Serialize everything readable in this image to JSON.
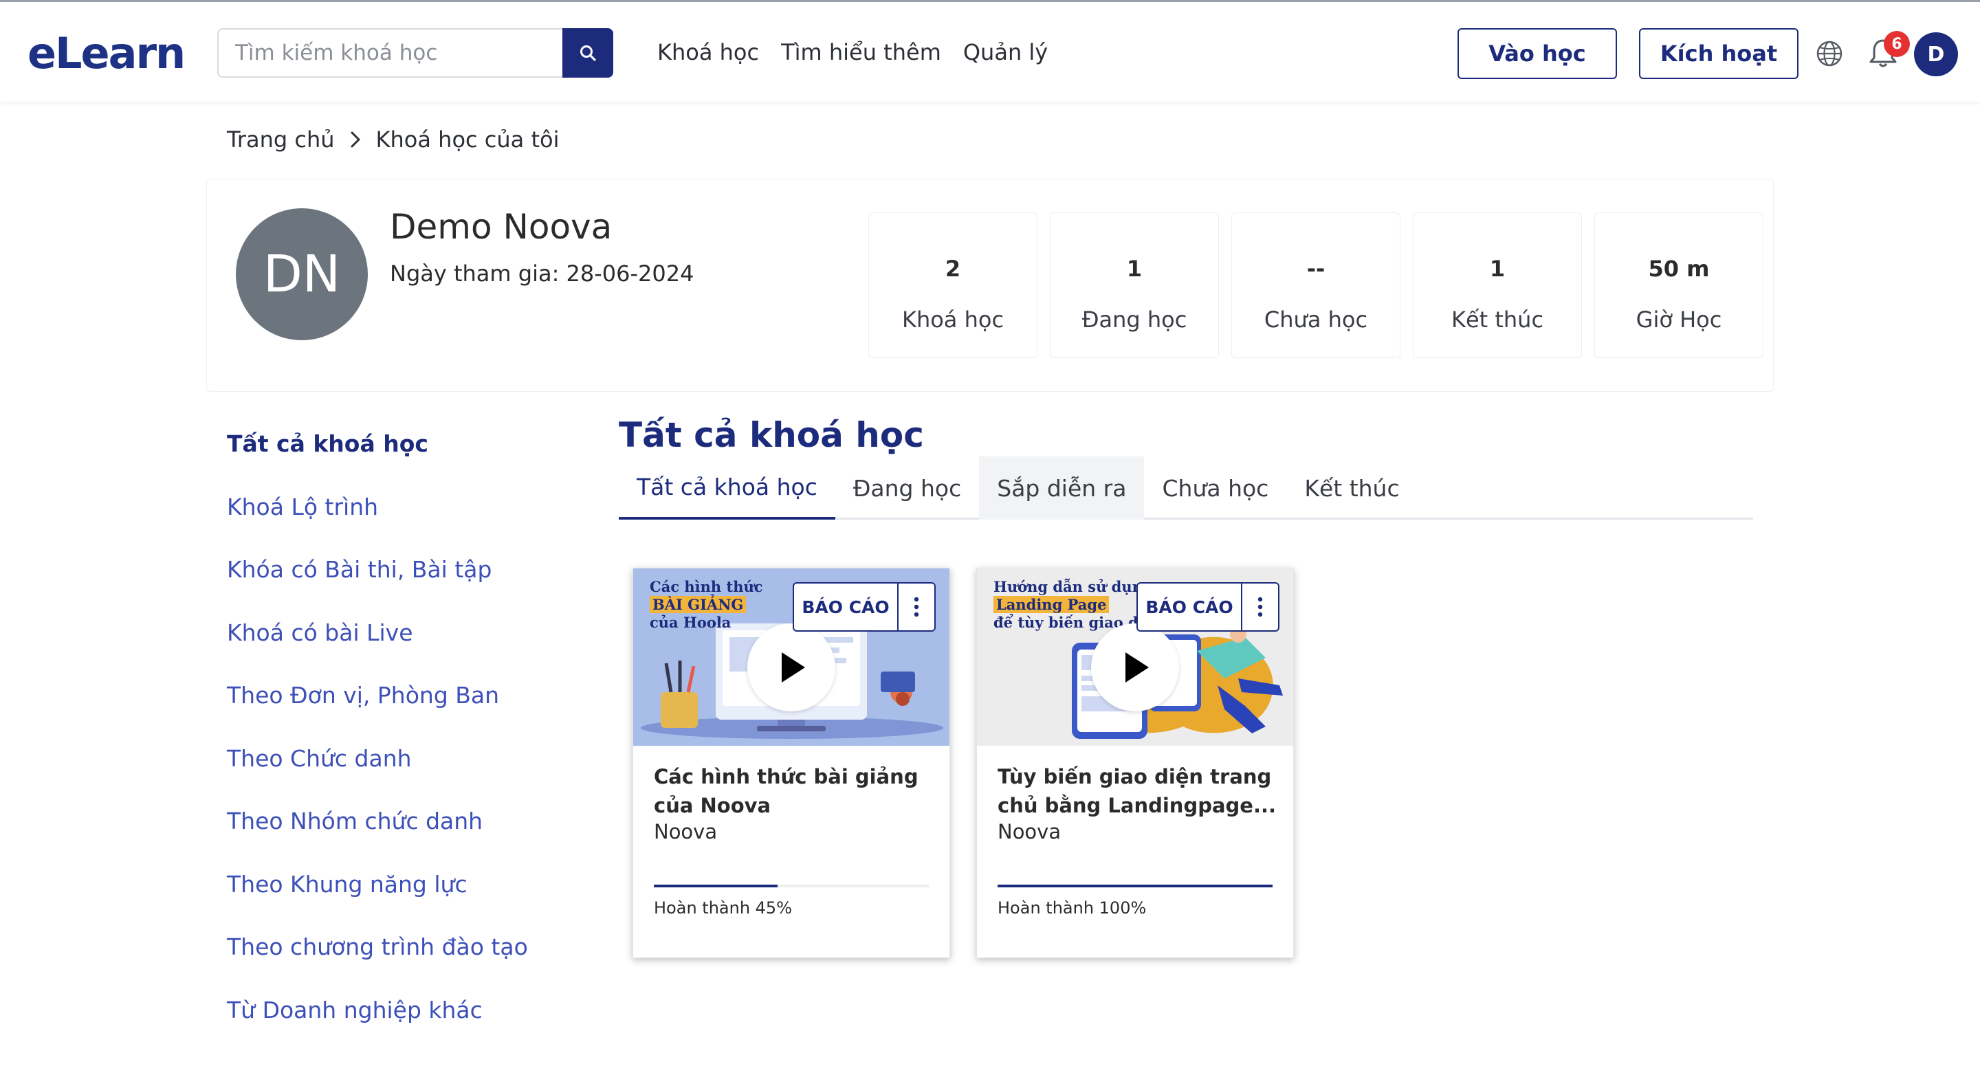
{
  "header": {
    "logo": "eLearn",
    "search_placeholder": "Tìm kiếm khoá học",
    "nav": [
      "Khoá học",
      "Tìm hiểu thêm",
      "Quản lý"
    ],
    "btn_vaohoc": "Vào học",
    "btn_kichhoat": "Kích hoạt",
    "notification_count": "6",
    "user_initial": "D",
    "accent": "#1d2b7d"
  },
  "breadcrumb": [
    "Trang chủ",
    "Khoá học của tôi"
  ],
  "profile": {
    "initials": "DN",
    "name": "Demo Noova",
    "joined": "Ngày tham gia: 28-06-2024",
    "stats": [
      {
        "value": "2",
        "label": "Khoá học"
      },
      {
        "value": "1",
        "label": "Đang học"
      },
      {
        "value": "--",
        "label": "Chưa học"
      },
      {
        "value": "1",
        "label": "Kết thúc"
      },
      {
        "value": "50 m",
        "label": "Giờ Học"
      }
    ]
  },
  "sidebar": [
    "Tất cả khoá học",
    "Khoá Lộ trình",
    "Khóa có Bài thi, Bài tập",
    "Khoá có bài Live",
    "Theo Đơn vị, Phòng Ban",
    "Theo Chức danh",
    "Theo Nhóm chức danh",
    "Theo Khung năng lực",
    "Theo chương trình đào tạo",
    "Từ Doanh nghiệp khác"
  ],
  "content": {
    "title": "Tất cả khoá học",
    "tabs": [
      "Tất cả khoá học",
      "Đang học",
      "Sắp diễn ra",
      "Chưa học",
      "Kết thúc"
    ]
  },
  "courses": [
    {
      "thumb_line1": "Các hình thức",
      "thumb_line2": "BÀI GIẢNG",
      "thumb_line3": "của Hoola",
      "report_label": "BÁO CÁO",
      "title": "Các hình thức bài giảng của Noova",
      "author": "Noova",
      "progress": 45,
      "progress_text": "Hoàn thành 45%"
    },
    {
      "thumb_line1": "Hướng dẫn sử dụng",
      "thumb_line2": "Landing Page",
      "thumb_line3": "để tùy biến giao diện",
      "report_label": "BÁO CÁO",
      "title": "Tùy biến giao diện trang chủ bằng Landingpage...",
      "author": "Noova",
      "progress": 100,
      "progress_text": "Hoàn thành 100%"
    }
  ]
}
